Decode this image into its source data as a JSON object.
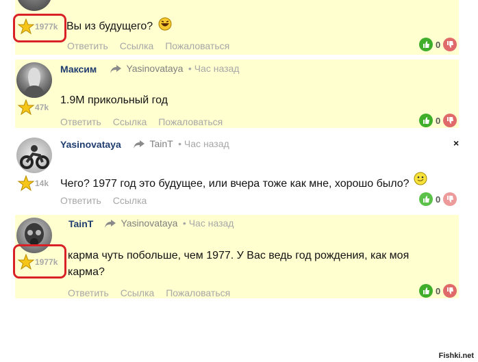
{
  "comments": [
    {
      "karma": "1977k",
      "text": "Вы из будущего?",
      "emoji": "laughing-emoji",
      "actions": [
        "Ответить",
        "Ссылка",
        "Пожаловаться"
      ],
      "votes": "0"
    },
    {
      "author": "Максим",
      "reply_to": "Yasinovataya",
      "time": "• Час назад",
      "karma": "47k",
      "text": "1.9M прикольный год",
      "actions": [
        "Ответить",
        "Ссылка",
        "Пожаловаться"
      ],
      "votes": "0"
    },
    {
      "author": "Yasinovataya",
      "reply_to": "TainT",
      "time": "• Час назад",
      "karma": "14k",
      "text": "Чего? 1977 год это будущее, или вчера тоже как мне, хорошо было?",
      "emoji": "tongue-emoji",
      "actions": [
        "Ответить",
        "Ссылка"
      ],
      "votes": "0",
      "close_mark": "×"
    },
    {
      "author": "TainT",
      "reply_to": "Yasinovataya",
      "time": "• Час назад",
      "karma": "1977k",
      "text": "карма чуть побольше, чем 1977. У Вас ведь год рождения, как моя карма?",
      "actions": [
        "Ответить",
        "Ссылка",
        "Пожаловаться"
      ],
      "votes": "0"
    }
  ],
  "watermark": "Fishki.net",
  "colors": {
    "highlight": "#ffffd0",
    "author": "#1e3c6e",
    "muted": "#a7a7a7",
    "like": "#3fae2a",
    "dislike": "#e06a6a",
    "annotation": "#d92026"
  }
}
